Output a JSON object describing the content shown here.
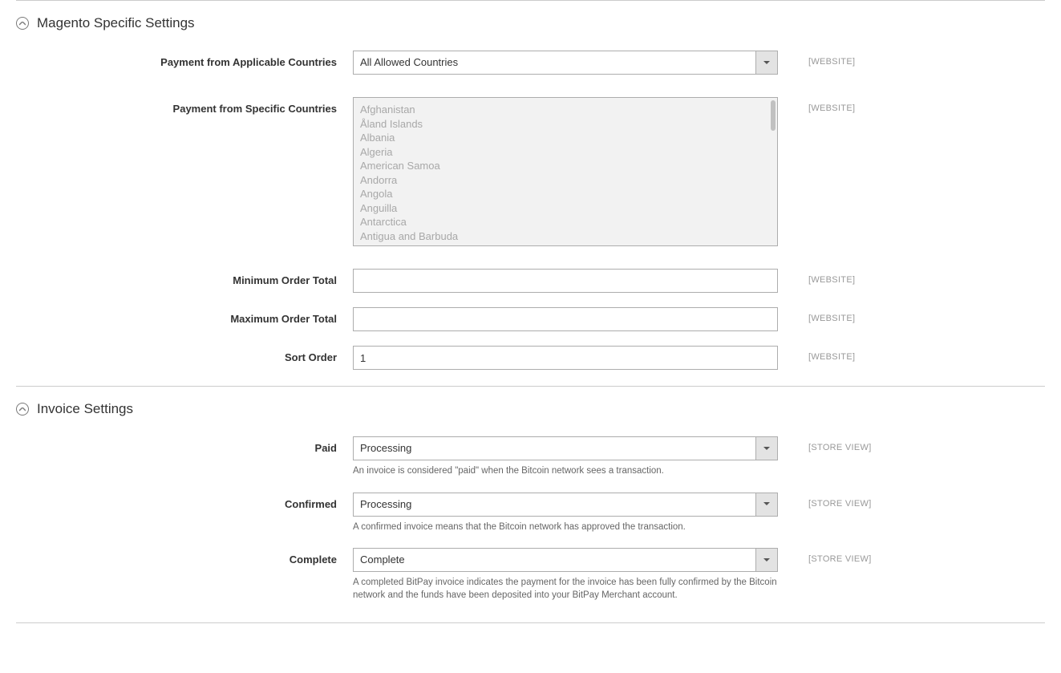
{
  "sections": {
    "magento": {
      "title": "Magento Specific Settings",
      "fields": {
        "applicable_countries": {
          "label": "Payment from Applicable Countries",
          "value": "All Allowed Countries",
          "scope": "[WEBSITE]"
        },
        "specific_countries": {
          "label": "Payment from Specific Countries",
          "options": [
            "Afghanistan",
            "Åland Islands",
            "Albania",
            "Algeria",
            "American Samoa",
            "Andorra",
            "Angola",
            "Anguilla",
            "Antarctica",
            "Antigua and Barbuda"
          ],
          "scope": "[WEBSITE]"
        },
        "min_order": {
          "label": "Minimum Order Total",
          "value": "",
          "scope": "[WEBSITE]"
        },
        "max_order": {
          "label": "Maximum Order Total",
          "value": "",
          "scope": "[WEBSITE]"
        },
        "sort_order": {
          "label": "Sort Order",
          "value": "1",
          "scope": "[WEBSITE]"
        }
      }
    },
    "invoice": {
      "title": "Invoice Settings",
      "fields": {
        "paid": {
          "label": "Paid",
          "value": "Processing",
          "note": "An invoice is considered \"paid\" when the Bitcoin network sees a transaction.",
          "scope": "[STORE VIEW]"
        },
        "confirmed": {
          "label": "Confirmed",
          "value": "Processing",
          "note": "A confirmed invoice means that the Bitcoin network has approved the transaction.",
          "scope": "[STORE VIEW]"
        },
        "complete": {
          "label": "Complete",
          "value": "Complete",
          "note": "A completed BitPay invoice indicates the payment for the invoice has been fully confirmed by the Bitcoin network and the funds have been deposited into your BitPay Merchant account.",
          "scope": "[STORE VIEW]"
        }
      }
    }
  }
}
